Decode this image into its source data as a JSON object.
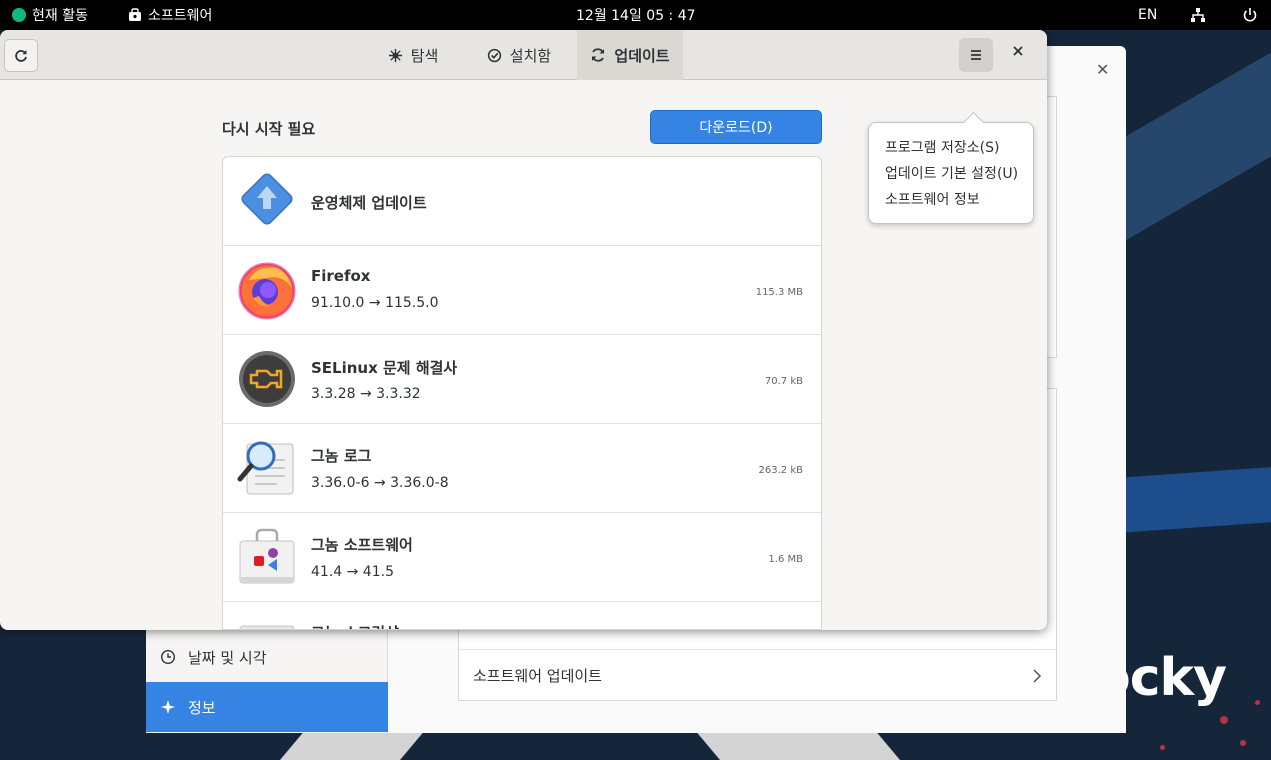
{
  "topbar": {
    "activities": "현재 활동",
    "app_name": "소프트웨어",
    "clock": "12월 14일  05 : 47",
    "language": "EN"
  },
  "settings_window": {
    "sidebar": [
      {
        "label": "날짜 및 시각",
        "icon": "clock-icon",
        "active": false
      },
      {
        "label": "정보",
        "icon": "sparkle-icon",
        "active": true
      }
    ],
    "rows": [
      {
        "label": "소프트웨어 업데이트"
      }
    ]
  },
  "software_window": {
    "tabs": [
      {
        "label": "탐색",
        "icon": "explore-icon",
        "active": false
      },
      {
        "label": "설치함",
        "icon": "installed-check-icon",
        "active": false
      },
      {
        "label": "업데이트",
        "icon": "updates-icon",
        "active": true
      }
    ],
    "section_title": "다시 시작 필요",
    "download_button": "다운로드(D)",
    "updates": [
      {
        "name": "운영체제 업데이트",
        "version": "",
        "size": "",
        "icon": "os-update-icon"
      },
      {
        "name": "Firefox",
        "version": "91.10.0 → 115.5.0",
        "size": "115.3 MB",
        "icon": "firefox-icon"
      },
      {
        "name": "SELinux 문제 해결사",
        "version": "3.3.28 → 3.3.32",
        "size": "70.7 kB",
        "icon": "selinux-icon"
      },
      {
        "name": "그놈 로그",
        "version": "3.36.0-6 → 3.36.0-8",
        "size": "263.2 kB",
        "icon": "logs-icon"
      },
      {
        "name": "그놈 소프트웨어",
        "version": "41.4 → 41.5",
        "size": "1.6 MB",
        "icon": "software-icon"
      },
      {
        "name": "그놈 스크린샷",
        "version": "",
        "size": "",
        "icon": "screenshot-icon"
      }
    ],
    "menu": [
      {
        "label": "프로그램 저장소(S)"
      },
      {
        "label": "업데이트 기본 설정(U)"
      },
      {
        "label": "소프트웨어 정보"
      }
    ]
  },
  "wallpaper": {
    "logo_text": "ocky"
  },
  "colors": {
    "accent": "#3584e4",
    "topbar": "#000000",
    "header": "#e7e5e2"
  }
}
